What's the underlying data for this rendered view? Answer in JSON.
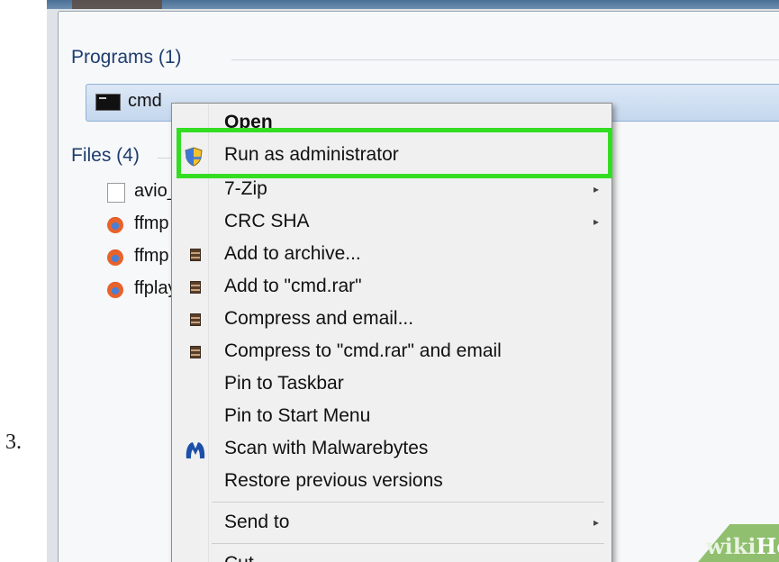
{
  "step_number": "3.",
  "search_results": {
    "programs_header": "Programs (1)",
    "program_item": {
      "label": "cmd",
      "icon": "cmd-icon"
    },
    "files_header": "Files (4)",
    "files": [
      {
        "label": "avio_",
        "icon": "document-icon"
      },
      {
        "label": "ffmp",
        "icon": "firefox-icon"
      },
      {
        "label": "ffmp",
        "icon": "firefox-icon"
      },
      {
        "label": "ffplay",
        "icon": "firefox-icon"
      }
    ]
  },
  "context_menu": {
    "items": [
      {
        "label": "Open",
        "bold": true
      },
      {
        "label": "Run as administrator",
        "icon": "uac-shield-icon",
        "highlighted": true
      },
      {
        "label": "7-Zip",
        "submenu": true
      },
      {
        "label": "CRC SHA",
        "submenu": true
      },
      {
        "label": "Add to archive...",
        "icon": "winrar-icon"
      },
      {
        "label": "Add to \"cmd.rar\"",
        "icon": "winrar-icon"
      },
      {
        "label": "Compress and email...",
        "icon": "winrar-icon"
      },
      {
        "label": "Compress to \"cmd.rar\" and email",
        "icon": "winrar-icon"
      },
      {
        "label": "Pin to Taskbar"
      },
      {
        "label": "Pin to Start Menu"
      },
      {
        "label": "Scan with Malwarebytes",
        "icon": "malwarebytes-icon"
      },
      {
        "label": "Restore previous versions"
      },
      {
        "label": "Send to",
        "submenu": true
      },
      {
        "label": "Cut"
      }
    ],
    "submenu_arrow": "▸"
  },
  "watermark": {
    "wiki": "wiki",
    "how": "How"
  },
  "colors": {
    "highlight": "#33dd22",
    "section_header": "#1e3d6e",
    "selected_row": "#c4d7ee"
  }
}
